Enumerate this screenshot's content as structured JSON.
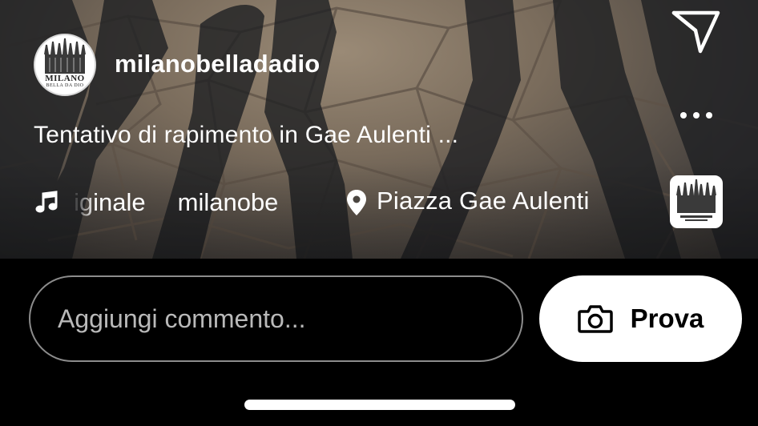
{
  "post": {
    "username": "milanobelladadio",
    "avatar_line1": "MILANO",
    "avatar_line2": "BELLA DA DIO",
    "caption": "Tentativo di rapimento in Gae Aulenti ...",
    "audio_text": "iginale",
    "audio_user": "milanobe",
    "location": "Piazza Gae Aulenti"
  },
  "icons": {
    "send": "send-icon",
    "more": "more-icon",
    "music": "music-note-icon",
    "location": "location-pin-icon",
    "camera": "camera-icon"
  },
  "footer": {
    "comment_placeholder": "Aggiungi commento...",
    "try_label": "Prova"
  },
  "colors": {
    "background": "#000000",
    "text": "#ffffff",
    "input_border": "#8c8c8c",
    "button_bg": "#ffffff"
  }
}
